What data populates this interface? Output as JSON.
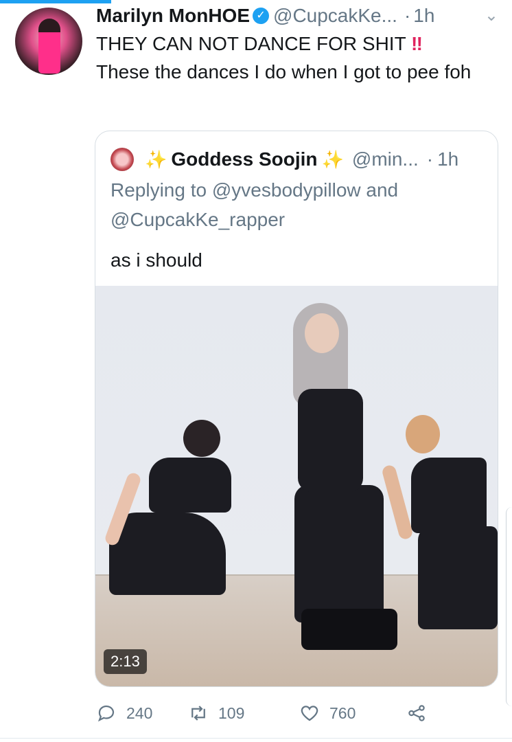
{
  "tweet": {
    "author_name": "Marilyn MonHOE",
    "verified_icon": "verified-badge-icon",
    "handle": "@CupcakKe...",
    "separator": "·",
    "time": "1h",
    "text_line1": "THEY CAN NOT DANCE FOR SHIT",
    "text_emphasis": "‼",
    "text_line2": "These the dances I do when I got to pee foh"
  },
  "quoted": {
    "sparkle_left": "✨",
    "author_name": "Goddess Soojin",
    "sparkle_right": "✨",
    "handle": "@min...",
    "separator": "·",
    "time": "1h",
    "replying_prefix": "Replying to",
    "reply_to_1": "@yvesbodypillow",
    "reply_joiner": "and",
    "reply_to_2": "@CupcakKe_rapper",
    "text": "as i should",
    "media": {
      "type": "video",
      "duration": "2:13"
    }
  },
  "actions": {
    "reply_count": "240",
    "retweet_count": "109",
    "like_count": "760",
    "icons": [
      "reply-icon",
      "retweet-icon",
      "like-icon",
      "share-icon"
    ]
  },
  "colors": {
    "accent": "#1da1f2",
    "muted": "#657786",
    "text": "#14171a",
    "emphasis": "#e0245e"
  }
}
